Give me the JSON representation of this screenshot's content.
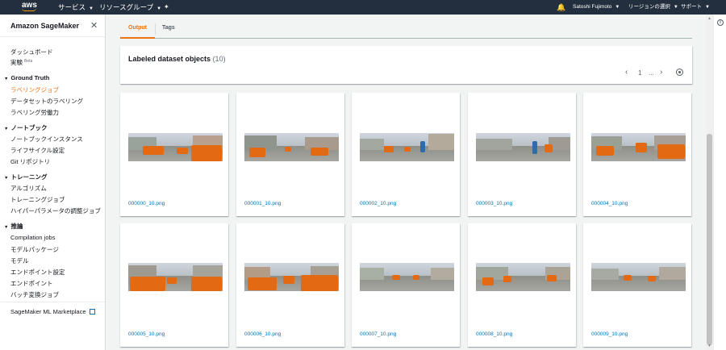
{
  "topnav": {
    "logo": "aws",
    "services": "サービス",
    "resource_groups": "リソースグループ",
    "pin_icon": "pin-icon",
    "bell_icon": "bell-icon",
    "user": "Satoshi Fujimoto",
    "region": "リージョンの選択",
    "support": "サポート"
  },
  "sidebar": {
    "title": "Amazon SageMaker",
    "dashboard": "ダッシュボード",
    "experiments": "実験",
    "experiments_badge": "Beta",
    "ground_truth": {
      "header": "Ground Truth",
      "items": [
        "ラベリングジョブ",
        "データセットのラベリング",
        "ラベリング労働力"
      ]
    },
    "notebook": {
      "header": "ノートブック",
      "items": [
        "ノートブックインスタンス",
        "ライフサイクル設定",
        "Git リポジトリ"
      ]
    },
    "training": {
      "header": "トレーニング",
      "items": [
        "アルゴリズム",
        "トレーニングジョブ",
        "ハイパーパラメータの調整ジョブ"
      ]
    },
    "inference": {
      "header": "推論",
      "items": [
        "Compilation jobs",
        "モデルパッケージ",
        "モデル",
        "エンドポイント設定",
        "エンドポイント",
        "バッチ変換ジョブ"
      ]
    },
    "marketplace": "SageMaker ML Marketplace"
  },
  "tabs": [
    "Output",
    "Tags"
  ],
  "panel": {
    "title": "Labeled dataset objects",
    "count": "(10)",
    "page": "1",
    "ellipsis": "..."
  },
  "items": [
    {
      "label": "000000_10.png"
    },
    {
      "label": "000001_10.png"
    },
    {
      "label": "000002_10.png"
    },
    {
      "label": "000003_10.png"
    },
    {
      "label": "000004_10.png"
    },
    {
      "label": "000005_10.png"
    },
    {
      "label": "000006_10.png"
    },
    {
      "label": "000007_10.png"
    },
    {
      "label": "000008_10.png"
    },
    {
      "label": "000009_10.png"
    }
  ],
  "colors": {
    "nav_bg": "#232f3e",
    "accent": "#ec7211",
    "link": "#0073bb",
    "label_overlay": "#e36a12"
  }
}
